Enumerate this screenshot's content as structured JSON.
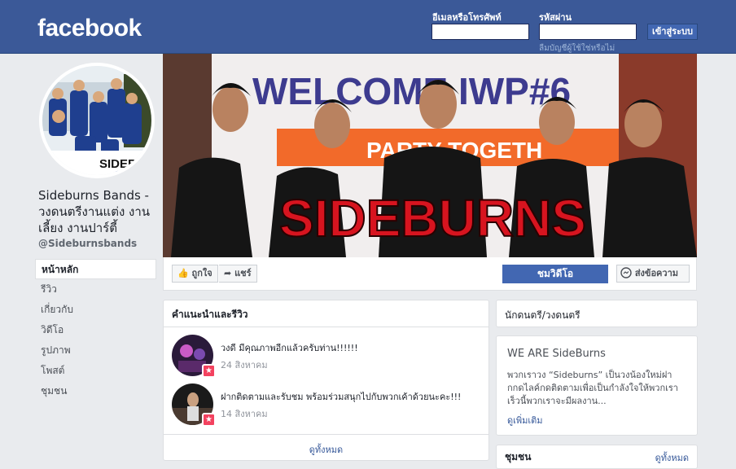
{
  "header": {
    "logo": "facebook",
    "email_label": "อีเมลหรือโทรศัพท์",
    "password_label": "รหัสผ่าน",
    "login_button": "เข้าสู่ระบบ",
    "forgot_link": "ลืมบัญชีผู้ใช้ใช่หรือไม่"
  },
  "profile": {
    "avatar_text": "SIDEBUR",
    "name": "Sideburns Bands - วงดนตรีงานแต่ง งานเลี้ยง งานปาร์ตี้",
    "handle": "@Sideburnsbands"
  },
  "nav": {
    "items": [
      {
        "label": "หน้าหลัก"
      },
      {
        "label": "รีวิว"
      },
      {
        "label": "เกี่ยวกับ"
      },
      {
        "label": "วิดีโอ"
      },
      {
        "label": "รูปภาพ"
      },
      {
        "label": "โพสต์"
      },
      {
        "label": "ชุมชน"
      }
    ]
  },
  "cover": {
    "banner_text": "WELCOME IWP#6",
    "banner_sub": "PARTY TOGETH",
    "band_name": "SIDEBURNS"
  },
  "actions": {
    "like": "ถูกใจ",
    "share": "แชร์",
    "watch_video": "ชมวิดีโอ",
    "send_message": "ส่งข้อความ"
  },
  "reviews": {
    "title": "คำแนะนำและรีวิว",
    "items": [
      {
        "text": "วงดี มีคุณภาพอีกแล้วครับท่าน!!!!!!",
        "date": "24 สิงหาคม",
        "badge": "★"
      },
      {
        "text": "ฝากติดตามและรับชม พร้อมร่วมสนุกไปกับพวกเค้าด้วยนะคะ!!!",
        "date": "14 สิงหาคม",
        "badge": "★"
      }
    ],
    "see_all": "ดูทั้งหมด"
  },
  "category": "นักดนตรี/วงดนตรี",
  "about": {
    "title": "WE ARE SideBurns",
    "description": "พวกเราวง “Sideburns” เป็นวงน้องใหม่ฝากกดไลค์กดติดตามเพื่อเป็นกำลังใจให้พวกเรา เร็วนี้พวกเราจะมีผลงาน...",
    "see_more": "ดูเพิ่มเติม"
  },
  "community": {
    "title": "ชุมชน",
    "see_all": "ดูทั้งหมด"
  },
  "colors": {
    "brand": "#3b5998",
    "button": "#4267b2",
    "link": "#365899",
    "band_red": "#d7141f"
  }
}
